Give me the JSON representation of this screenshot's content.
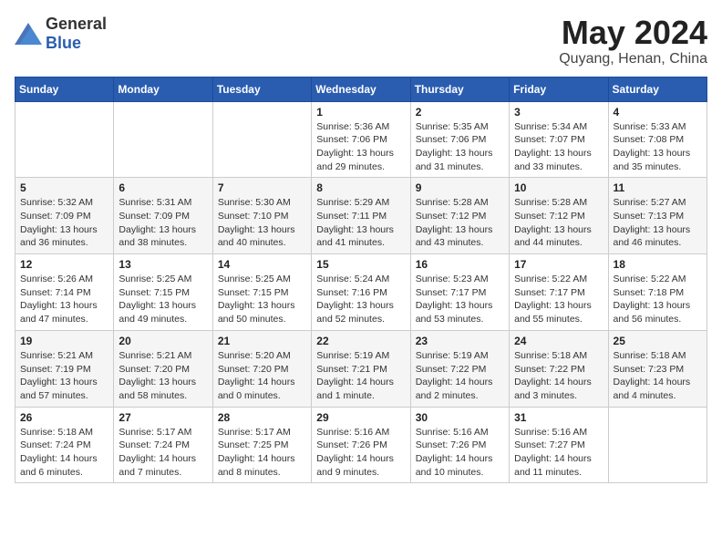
{
  "header": {
    "logo_general": "General",
    "logo_blue": "Blue",
    "month": "May 2024",
    "location": "Quyang, Henan, China"
  },
  "days_of_week": [
    "Sunday",
    "Monday",
    "Tuesday",
    "Wednesday",
    "Thursday",
    "Friday",
    "Saturday"
  ],
  "weeks": [
    [
      {
        "day": "",
        "info": ""
      },
      {
        "day": "",
        "info": ""
      },
      {
        "day": "",
        "info": ""
      },
      {
        "day": "1",
        "info": "Sunrise: 5:36 AM\nSunset: 7:06 PM\nDaylight: 13 hours\nand 29 minutes."
      },
      {
        "day": "2",
        "info": "Sunrise: 5:35 AM\nSunset: 7:06 PM\nDaylight: 13 hours\nand 31 minutes."
      },
      {
        "day": "3",
        "info": "Sunrise: 5:34 AM\nSunset: 7:07 PM\nDaylight: 13 hours\nand 33 minutes."
      },
      {
        "day": "4",
        "info": "Sunrise: 5:33 AM\nSunset: 7:08 PM\nDaylight: 13 hours\nand 35 minutes."
      }
    ],
    [
      {
        "day": "5",
        "info": "Sunrise: 5:32 AM\nSunset: 7:09 PM\nDaylight: 13 hours\nand 36 minutes."
      },
      {
        "day": "6",
        "info": "Sunrise: 5:31 AM\nSunset: 7:09 PM\nDaylight: 13 hours\nand 38 minutes."
      },
      {
        "day": "7",
        "info": "Sunrise: 5:30 AM\nSunset: 7:10 PM\nDaylight: 13 hours\nand 40 minutes."
      },
      {
        "day": "8",
        "info": "Sunrise: 5:29 AM\nSunset: 7:11 PM\nDaylight: 13 hours\nand 41 minutes."
      },
      {
        "day": "9",
        "info": "Sunrise: 5:28 AM\nSunset: 7:12 PM\nDaylight: 13 hours\nand 43 minutes."
      },
      {
        "day": "10",
        "info": "Sunrise: 5:28 AM\nSunset: 7:12 PM\nDaylight: 13 hours\nand 44 minutes."
      },
      {
        "day": "11",
        "info": "Sunrise: 5:27 AM\nSunset: 7:13 PM\nDaylight: 13 hours\nand 46 minutes."
      }
    ],
    [
      {
        "day": "12",
        "info": "Sunrise: 5:26 AM\nSunset: 7:14 PM\nDaylight: 13 hours\nand 47 minutes."
      },
      {
        "day": "13",
        "info": "Sunrise: 5:25 AM\nSunset: 7:15 PM\nDaylight: 13 hours\nand 49 minutes."
      },
      {
        "day": "14",
        "info": "Sunrise: 5:25 AM\nSunset: 7:15 PM\nDaylight: 13 hours\nand 50 minutes."
      },
      {
        "day": "15",
        "info": "Sunrise: 5:24 AM\nSunset: 7:16 PM\nDaylight: 13 hours\nand 52 minutes."
      },
      {
        "day": "16",
        "info": "Sunrise: 5:23 AM\nSunset: 7:17 PM\nDaylight: 13 hours\nand 53 minutes."
      },
      {
        "day": "17",
        "info": "Sunrise: 5:22 AM\nSunset: 7:17 PM\nDaylight: 13 hours\nand 55 minutes."
      },
      {
        "day": "18",
        "info": "Sunrise: 5:22 AM\nSunset: 7:18 PM\nDaylight: 13 hours\nand 56 minutes."
      }
    ],
    [
      {
        "day": "19",
        "info": "Sunrise: 5:21 AM\nSunset: 7:19 PM\nDaylight: 13 hours\nand 57 minutes."
      },
      {
        "day": "20",
        "info": "Sunrise: 5:21 AM\nSunset: 7:20 PM\nDaylight: 13 hours\nand 58 minutes."
      },
      {
        "day": "21",
        "info": "Sunrise: 5:20 AM\nSunset: 7:20 PM\nDaylight: 14 hours\nand 0 minutes."
      },
      {
        "day": "22",
        "info": "Sunrise: 5:19 AM\nSunset: 7:21 PM\nDaylight: 14 hours\nand 1 minute."
      },
      {
        "day": "23",
        "info": "Sunrise: 5:19 AM\nSunset: 7:22 PM\nDaylight: 14 hours\nand 2 minutes."
      },
      {
        "day": "24",
        "info": "Sunrise: 5:18 AM\nSunset: 7:22 PM\nDaylight: 14 hours\nand 3 minutes."
      },
      {
        "day": "25",
        "info": "Sunrise: 5:18 AM\nSunset: 7:23 PM\nDaylight: 14 hours\nand 4 minutes."
      }
    ],
    [
      {
        "day": "26",
        "info": "Sunrise: 5:18 AM\nSunset: 7:24 PM\nDaylight: 14 hours\nand 6 minutes."
      },
      {
        "day": "27",
        "info": "Sunrise: 5:17 AM\nSunset: 7:24 PM\nDaylight: 14 hours\nand 7 minutes."
      },
      {
        "day": "28",
        "info": "Sunrise: 5:17 AM\nSunset: 7:25 PM\nDaylight: 14 hours\nand 8 minutes."
      },
      {
        "day": "29",
        "info": "Sunrise: 5:16 AM\nSunset: 7:26 PM\nDaylight: 14 hours\nand 9 minutes."
      },
      {
        "day": "30",
        "info": "Sunrise: 5:16 AM\nSunset: 7:26 PM\nDaylight: 14 hours\nand 10 minutes."
      },
      {
        "day": "31",
        "info": "Sunrise: 5:16 AM\nSunset: 7:27 PM\nDaylight: 14 hours\nand 11 minutes."
      },
      {
        "day": "",
        "info": ""
      }
    ]
  ]
}
